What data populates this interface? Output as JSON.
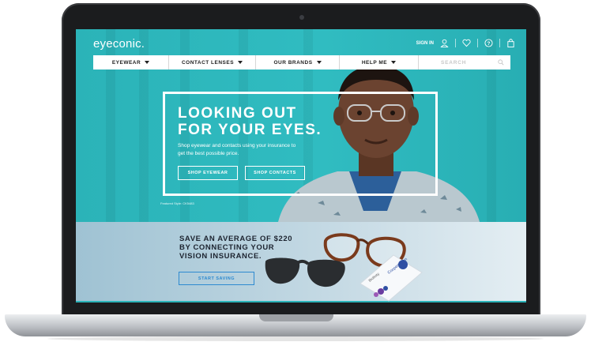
{
  "header": {
    "logo": "eyeconic.",
    "sign_in": "SIGN IN",
    "icons": [
      "user-icon",
      "heart-icon",
      "help-icon",
      "bag-icon"
    ]
  },
  "nav": {
    "items": [
      {
        "label": "EYEWEAR"
      },
      {
        "label": "CONTACT LENSES"
      },
      {
        "label": "OUR BRANDS"
      },
      {
        "label": "HELP ME"
      }
    ],
    "search_placeholder": "SEARCH"
  },
  "hero": {
    "headline_line1": "LOOKING OUT",
    "headline_line2": "FOR YOUR EYES.",
    "subcopy": "Shop eyewear and contacts using your insurance to get the best possible price.",
    "shop_eyewear": "SHOP EYEWEAR",
    "shop_contacts": "SHOP CONTACTS",
    "featured_style": "Featured Style: CK5483"
  },
  "promo": {
    "line1": "SAVE AN AVERAGE OF $220",
    "line2": "BY CONNECTING YOUR",
    "line3": "VISION INSURANCE.",
    "cta": "START SAVING",
    "box_brand": "CooperVision",
    "box_name": "Biofinity"
  },
  "colors": {
    "hero_teal": "#2bb4b9",
    "promo_blue": "#2d8ad0",
    "text_dark": "#1d2430"
  }
}
